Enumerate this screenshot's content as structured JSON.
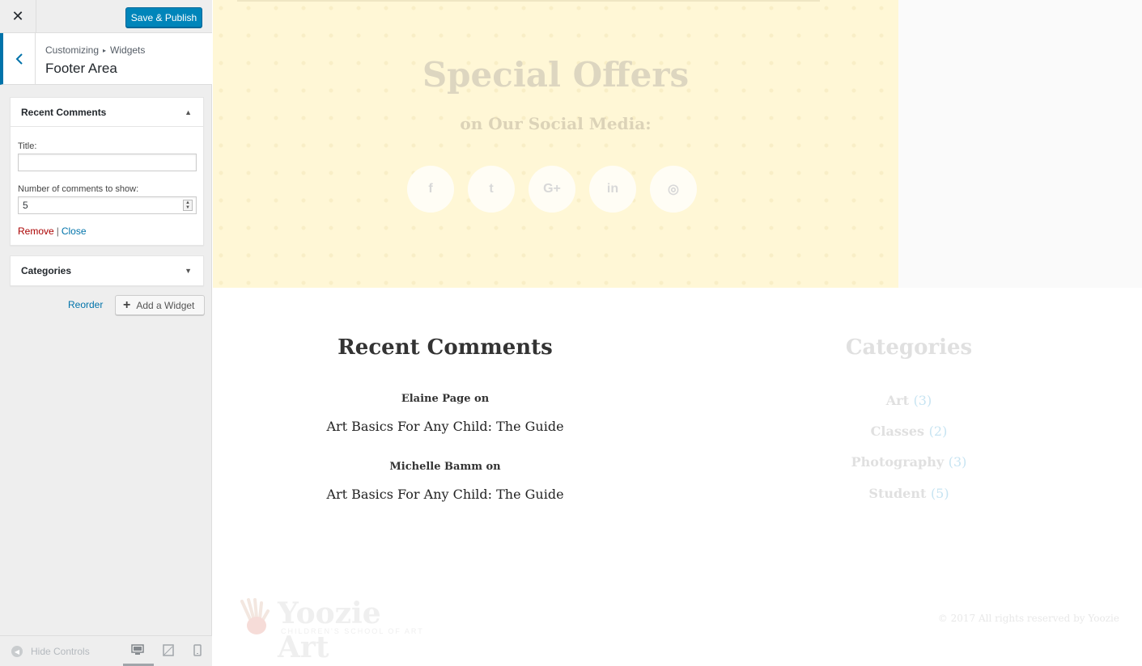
{
  "topbar": {
    "close_label": "✕",
    "publish_label": "Save & Publish"
  },
  "section": {
    "breadcrumb_root": "Customizing",
    "breadcrumb_sep": "▸",
    "breadcrumb_child": "Widgets",
    "title": "Footer Area"
  },
  "widgets": [
    {
      "title": "Recent Comments",
      "expanded": true,
      "title_label": "Title:",
      "title_value": "",
      "count_label": "Number of comments to show:",
      "count_value": "5",
      "remove_label": "Remove",
      "separator": "|",
      "close_label": "Close"
    },
    {
      "title": "Categories",
      "expanded": false
    }
  ],
  "actions": {
    "reorder_label": "Reorder",
    "add_widget_label": "Add a Widget"
  },
  "bottom_bar": {
    "hide_controls_label": "Hide Controls",
    "active_device": "desktop"
  },
  "preview": {
    "offers": {
      "title": "Special Offers",
      "subtitle": "on Our Social Media:",
      "social_icons": [
        "facebook-icon",
        "twitter-icon",
        "google-plus-icon",
        "linkedin-icon",
        "instagram-icon"
      ],
      "social_glyphs": [
        "f",
        "t",
        "G+",
        "in",
        "◎"
      ]
    },
    "recent_comments": {
      "title": "Recent Comments",
      "items": [
        {
          "author": "Elaine Page on",
          "post": "Art Basics For Any Child: The Guide"
        },
        {
          "author": "Michelle Bamm on",
          "post": "Art Basics For Any Child: The Guide"
        }
      ]
    },
    "categories": {
      "title": "Categories",
      "items": [
        {
          "name": "Art",
          "count": "(3)"
        },
        {
          "name": "Classes",
          "count": "(2)"
        },
        {
          "name": "Photography",
          "count": "(3)"
        },
        {
          "name": "Student",
          "count": "(5)"
        }
      ]
    },
    "footer": {
      "logo_name": "Yoozie Art",
      "logo_tagline": "CHILDREN'S SCHOOL OF ART",
      "copyright": "© 2017 All rights reserved by Yoozie"
    }
  },
  "colors": {
    "accent": "#0073aa",
    "publish": "#0085ba",
    "remove": "#aa0000",
    "offers_bg": "#fff7d6"
  }
}
